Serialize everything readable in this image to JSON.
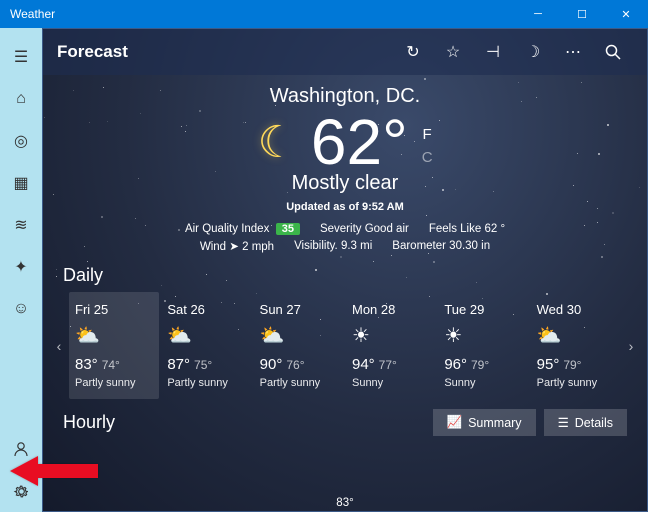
{
  "window": {
    "title": "Weather"
  },
  "header": {
    "title": "Forecast"
  },
  "hero": {
    "location": "Washington, DC.",
    "temp": "62°",
    "unit_f": "F",
    "unit_c": "C",
    "condition": "Mostly clear",
    "updated": "Updated as of 9:52 AM"
  },
  "stats": {
    "aqi_label": "Air Quality Index",
    "aqi_value": "35",
    "severity_label": "Severity",
    "severity_value": "Good air",
    "feels_label": "Feels Like",
    "feels_value": "62 °",
    "wind_label": "Wind",
    "wind_value": "2 mph",
    "visibility_label": "Visibility.",
    "visibility_value": "9.3 mi",
    "barometer_label": "Barometer",
    "barometer_value": "30.30 in"
  },
  "sections": {
    "daily": "Daily",
    "hourly": "Hourly"
  },
  "daily": [
    {
      "name": "Fri 25",
      "hi": "83°",
      "lo": "74°",
      "cond": "Partly sunny",
      "icon": "⛅"
    },
    {
      "name": "Sat 26",
      "hi": "87°",
      "lo": "75°",
      "cond": "Partly sunny",
      "icon": "⛅"
    },
    {
      "name": "Sun 27",
      "hi": "90°",
      "lo": "76°",
      "cond": "Partly sunny",
      "icon": "⛅"
    },
    {
      "name": "Mon 28",
      "hi": "94°",
      "lo": "77°",
      "cond": "Sunny",
      "icon": "☀"
    },
    {
      "name": "Tue 29",
      "hi": "96°",
      "lo": "79°",
      "cond": "Sunny",
      "icon": "☀"
    },
    {
      "name": "Wed 30",
      "hi": "95°",
      "lo": "79°",
      "cond": "Partly sunny",
      "icon": "⛅"
    }
  ],
  "buttons": {
    "summary": "Summary",
    "details": "Details"
  },
  "bottom_temp": "83°"
}
